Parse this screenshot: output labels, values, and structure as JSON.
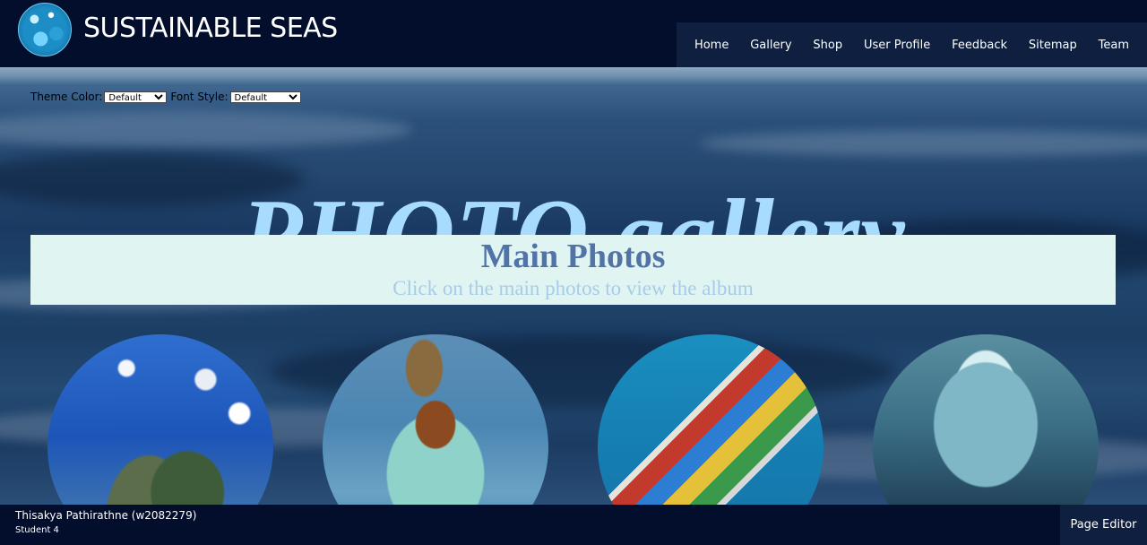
{
  "header": {
    "logo_icon": "ocean-globe-icon",
    "site_title": "SUSTAINABLE SEAS",
    "nav": [
      {
        "label": "Home"
      },
      {
        "label": "Gallery"
      },
      {
        "label": "Shop"
      },
      {
        "label": "User Profile"
      },
      {
        "label": "Feedback"
      },
      {
        "label": "Sitemap"
      },
      {
        "label": "Team"
      }
    ]
  },
  "settings": {
    "theme_label": "Theme Color:",
    "theme_value": "Default",
    "font_label": "Font Style:",
    "font_value": "Default"
  },
  "main": {
    "page_title": "PHOTO gallery",
    "section_heading": "Main Photos",
    "section_subtitle": "Click on the main photos to view the album",
    "photos": [
      {
        "subject": "sea turtle with plastic"
      },
      {
        "subject": "fisherman with net"
      },
      {
        "subject": "cargo ship aerial"
      },
      {
        "subject": "aquarium tunnel"
      }
    ]
  },
  "footer": {
    "student_name": "Thisakya Pathirathne (w2082279)",
    "student_label": "Student 4",
    "page_editor_label": "Page Editor"
  },
  "colors": {
    "header_bg": "#020e2c",
    "nav_bg": "#0f1f3f",
    "title_color": "#a7dcff",
    "box_bg": "#e0f5f2",
    "heading_color": "#5273a8",
    "subtitle_color": "#a7cbe8"
  }
}
